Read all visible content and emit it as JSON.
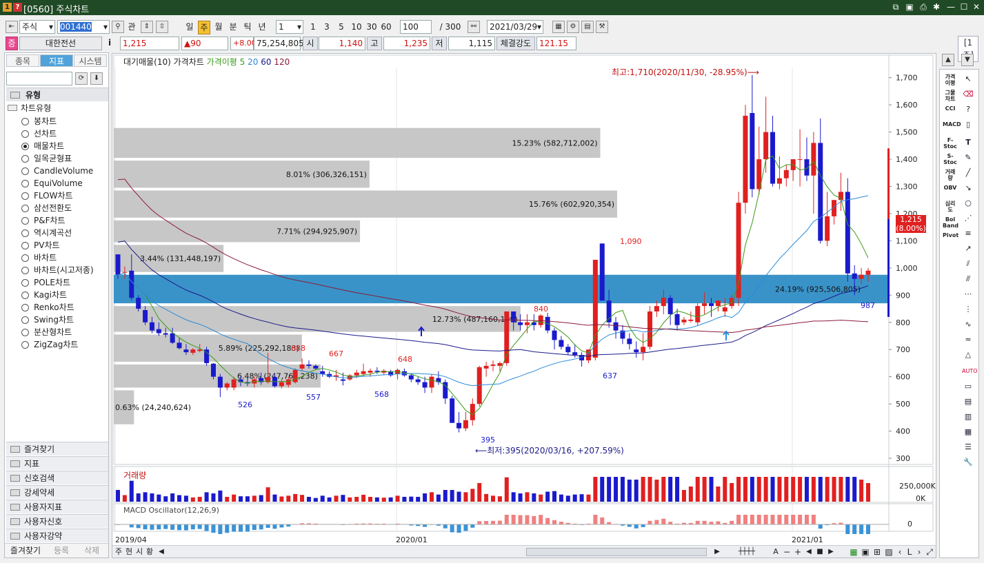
{
  "window": {
    "title": "[0560] 주식차트",
    "tag": "[1주]"
  },
  "toolbar": {
    "market": "주식",
    "code": "001440",
    "search_btn": "관",
    "periods": [
      "일",
      "주",
      "월",
      "분",
      "틱",
      "년"
    ],
    "active_period": "주",
    "unit": "1",
    "intervals": [
      "1",
      "3",
      "5",
      "10",
      "30",
      "60"
    ],
    "count": "100",
    "total": "/ 300",
    "date": "2021/03/29"
  },
  "quote": {
    "badge": "증",
    "name": "대한전선",
    "info_btn": "i",
    "price": "1,215",
    "change": "▲90",
    "pct": "+8.00%",
    "volume": "75,254,805",
    "open_label": "시",
    "open": "1,140",
    "high_label": "고",
    "high": "1,235",
    "low_label": "저",
    "low": "1,115",
    "strength_label": "체결강도",
    "strength": "121.15"
  },
  "left_panel": {
    "tabs": [
      "종목",
      "지표",
      "시스템"
    ],
    "active_tab": "지표",
    "section": "유형",
    "group": "차트유형",
    "chart_types": [
      "봉차트",
      "선차트",
      "매물차트",
      "일목균형표",
      "CandleVolume",
      "EquiVolume",
      "FLOW차트",
      "삼선전환도",
      "P&F차트",
      "역시계곡선",
      "PV차트",
      "바차트",
      "바차트(시고저종)",
      "POLE차트",
      "Kagi차트",
      "Renko차트",
      "Swing차트",
      "분산형차트",
      "ZigZag차트"
    ],
    "selected_type": "매물차트",
    "folders": [
      "즐겨찾기",
      "지표",
      "신호검색",
      "강세약세",
      "사용자지표",
      "사용자신호",
      "사용자강약"
    ],
    "bottom_tabs": [
      "즐겨찾기",
      "등록",
      "삭제"
    ]
  },
  "legend": {
    "items": [
      "대기매물(10)",
      "가격차트",
      "가격이평",
      "5",
      "20",
      "60",
      "120"
    ]
  },
  "colors": {
    "up": "#e02020",
    "down": "#1a1acc",
    "ma5": "#3a9a1a",
    "ma20": "#2a8ad8",
    "ma60": "#1a1a8a",
    "ma120": "#8a1a3a",
    "profile": "#c4c4c4",
    "profile_hl": "#3a93c8",
    "title_bg": "#1f4a25",
    "tab_active": "#4fa3d9"
  },
  "annotations": {
    "high": "최고:1,710(2020/11/30, -28.95%)⟶",
    "low": "⟵최저:395(2020/03/16, +207.59%)",
    "current": "1,215",
    "current_pct": "(8.00%)"
  },
  "volume_panel": {
    "title": "거래량",
    "ticks": [
      "250,000K",
      "0K"
    ]
  },
  "macd_panel": {
    "title": "MACD Oscillator(12,26,9)",
    "ticks": [
      "0"
    ]
  },
  "x_axis": [
    "2019/04",
    "2020/01",
    "2021/01"
  ],
  "bottom_bar": [
    "주",
    "현",
    "시",
    "황"
  ],
  "right_tools": [
    "가격이평",
    "그물차트",
    "CCI",
    "MACD",
    "F-Stoc",
    "S-Stoc",
    "거래량",
    "OBV",
    "심리도",
    "Bol Band",
    "Pivot"
  ],
  "chart_data": {
    "type": "candlestick",
    "ylim": [
      300,
      1750
    ],
    "yticks": [
      300,
      400,
      500,
      600,
      700,
      800,
      900,
      1000,
      1100,
      1200,
      1300,
      1400,
      1500,
      1600,
      1700
    ],
    "candles": [
      [
        1050,
        1050,
        960,
        975
      ],
      [
        985,
        1005,
        960,
        985
      ],
      [
        990,
        1050,
        880,
        890
      ],
      [
        890,
        900,
        840,
        850
      ],
      [
        845,
        860,
        790,
        800
      ],
      [
        800,
        820,
        760,
        770
      ],
      [
        775,
        800,
        750,
        760
      ],
      [
        760,
        780,
        745,
        755
      ],
      [
        760,
        780,
        720,
        725
      ],
      [
        725,
        745,
        700,
        705
      ],
      [
        700,
        720,
        680,
        690
      ],
      [
        688,
        705,
        680,
        700
      ],
      [
        695,
        720,
        690,
        700
      ],
      [
        700,
        710,
        640,
        650
      ],
      [
        648,
        650,
        590,
        600
      ],
      [
        600,
        610,
        525,
        560
      ],
      [
        560,
        580,
        550,
        575
      ],
      [
        560,
        600,
        550,
        590
      ],
      [
        590,
        600,
        565,
        580
      ],
      [
        580,
        600,
        565,
        575
      ],
      [
        575,
        600,
        560,
        590
      ],
      [
        595,
        615,
        570,
        580
      ],
      [
        580,
        688,
        575,
        598
      ],
      [
        598,
        610,
        560,
        565
      ],
      [
        565,
        590,
        557,
        580
      ],
      [
        570,
        600,
        560,
        590
      ],
      [
        580,
        630,
        575,
        625
      ],
      [
        630,
        667,
        620,
        645
      ],
      [
        645,
        660,
        630,
        640
      ],
      [
        640,
        645,
        625,
        630
      ],
      [
        620,
        640,
        600,
        610
      ],
      [
        610,
        620,
        595,
        600
      ],
      [
        600,
        625,
        585,
        605
      ],
      [
        590,
        615,
        568,
        585
      ],
      [
        590,
        610,
        585,
        605
      ],
      [
        605,
        625,
        595,
        615
      ],
      [
        610,
        648,
        600,
        620
      ],
      [
        615,
        630,
        600,
        622
      ],
      [
        622,
        635,
        610,
        618
      ],
      [
        615,
        628,
        605,
        622
      ],
      [
        620,
        625,
        600,
        605
      ],
      [
        610,
        630,
        590,
        625
      ],
      [
        620,
        630,
        600,
        605
      ],
      [
        605,
        612,
        580,
        590
      ],
      [
        590,
        600,
        570,
        580
      ],
      [
        580,
        600,
        540,
        560
      ],
      [
        560,
        610,
        540,
        600
      ],
      [
        595,
        620,
        570,
        580
      ],
      [
        580,
        590,
        500,
        520
      ],
      [
        520,
        530,
        440,
        430
      ],
      [
        430,
        470,
        395,
        410
      ],
      [
        410,
        470,
        400,
        440
      ],
      [
        440,
        520,
        420,
        500
      ],
      [
        500,
        640,
        490,
        635
      ],
      [
        630,
        655,
        600,
        640
      ],
      [
        640,
        660,
        620,
        645
      ],
      [
        640,
        655,
        620,
        650
      ],
      [
        650,
        840,
        640,
        840
      ],
      [
        840,
        840,
        770,
        800
      ],
      [
        800,
        830,
        770,
        790
      ],
      [
        790,
        830,
        760,
        800
      ],
      [
        800,
        830,
        770,
        790
      ],
      [
        790,
        830,
        780,
        825
      ],
      [
        820,
        835,
        760,
        770
      ],
      [
        770,
        780,
        700,
        735
      ],
      [
        735,
        750,
        700,
        710
      ],
      [
        710,
        720,
        680,
        690
      ],
      [
        690,
        720,
        670,
        680
      ],
      [
        680,
        690,
        637,
        660
      ],
      [
        660,
        700,
        650,
        700
      ],
      [
        670,
        970,
        660,
        1030
      ],
      [
        1090,
        1090,
        880,
        880
      ],
      [
        880,
        920,
        780,
        800
      ],
      [
        800,
        820,
        740,
        770
      ],
      [
        770,
        790,
        720,
        740
      ],
      [
        740,
        760,
        700,
        720
      ],
      [
        700,
        730,
        670,
        690
      ],
      [
        690,
        760,
        660,
        710
      ],
      [
        710,
        860,
        700,
        840
      ],
      [
        840,
        880,
        820,
        860
      ],
      [
        860,
        920,
        830,
        890
      ],
      [
        890,
        900,
        790,
        830
      ],
      [
        830,
        850,
        770,
        790
      ],
      [
        800,
        820,
        790,
        810
      ],
      [
        805,
        840,
        800,
        810
      ],
      [
        800,
        870,
        790,
        860
      ],
      [
        860,
        910,
        830,
        870
      ],
      [
        870,
        890,
        820,
        860
      ],
      [
        860,
        880,
        840,
        880
      ],
      [
        840,
        890,
        820,
        855
      ],
      [
        860,
        900,
        850,
        890
      ],
      [
        890,
        1280,
        860,
        1240
      ],
      [
        1240,
        1600,
        1200,
        1560
      ],
      [
        1570,
        1710,
        1260,
        1290
      ],
      [
        1290,
        1520,
        1270,
        1400
      ],
      [
        1400,
        1630,
        1350,
        1500
      ],
      [
        1500,
        1560,
        1300,
        1310
      ],
      [
        1310,
        1410,
        1290,
        1330
      ],
      [
        1330,
        1380,
        1300,
        1360
      ],
      [
        1360,
        1400,
        1320,
        1400
      ],
      [
        1400,
        1510,
        1300,
        1400
      ],
      [
        1400,
        1480,
        1320,
        1340
      ],
      [
        1340,
        1500,
        1200,
        1460
      ],
      [
        1460,
        1550,
        1090,
        1100
      ],
      [
        1100,
        1280,
        1080,
        1190
      ],
      [
        1190,
        1250,
        1160,
        1250
      ],
      [
        1250,
        1350,
        1210,
        1280
      ],
      [
        1280,
        1330,
        950,
        980
      ],
      [
        980,
        1010,
        900,
        960
      ],
      [
        960,
        1000,
        940,
        975
      ],
      [
        975,
        1000,
        950,
        990
      ]
    ],
    "volume_profile": [
      {
        "pct": "15.23%",
        "vol": "(582,712,002)",
        "lo": 1400,
        "hi": 1520
      },
      {
        "pct": "8.01%",
        "vol": "(306,326,151)",
        "lo": 1290,
        "hi": 1400
      },
      {
        "pct": "15.76%",
        "vol": "(602,920,354)",
        "lo": 1180,
        "hi": 1290
      },
      {
        "pct": "7.71%",
        "vol": "(294,925,907)",
        "lo": 1090,
        "hi": 1180
      },
      {
        "pct": "3.44%",
        "vol": "(131,448,197)",
        "lo": 980,
        "hi": 1090
      },
      {
        "pct": "24.19%",
        "vol": "(925,506,805)",
        "lo": 865,
        "hi": 980,
        "hl": true
      },
      {
        "pct": "12.73%",
        "vol": "(487,160,109)",
        "lo": 760,
        "hi": 865
      },
      {
        "pct": "5.89%",
        "vol": "(225,292,183)",
        "lo": 650,
        "hi": 760
      },
      {
        "pct": "6.48%",
        "vol": "(247,763,238)",
        "lo": 555,
        "hi": 650
      },
      {
        "pct": "0.63%",
        "vol": "(24,240,624)",
        "lo": 420,
        "hi": 555
      }
    ],
    "price_labels": [
      "1,090",
      "840",
      "688",
      "667",
      "648",
      "637",
      "526",
      "557",
      "568",
      "395",
      "987"
    ]
  }
}
